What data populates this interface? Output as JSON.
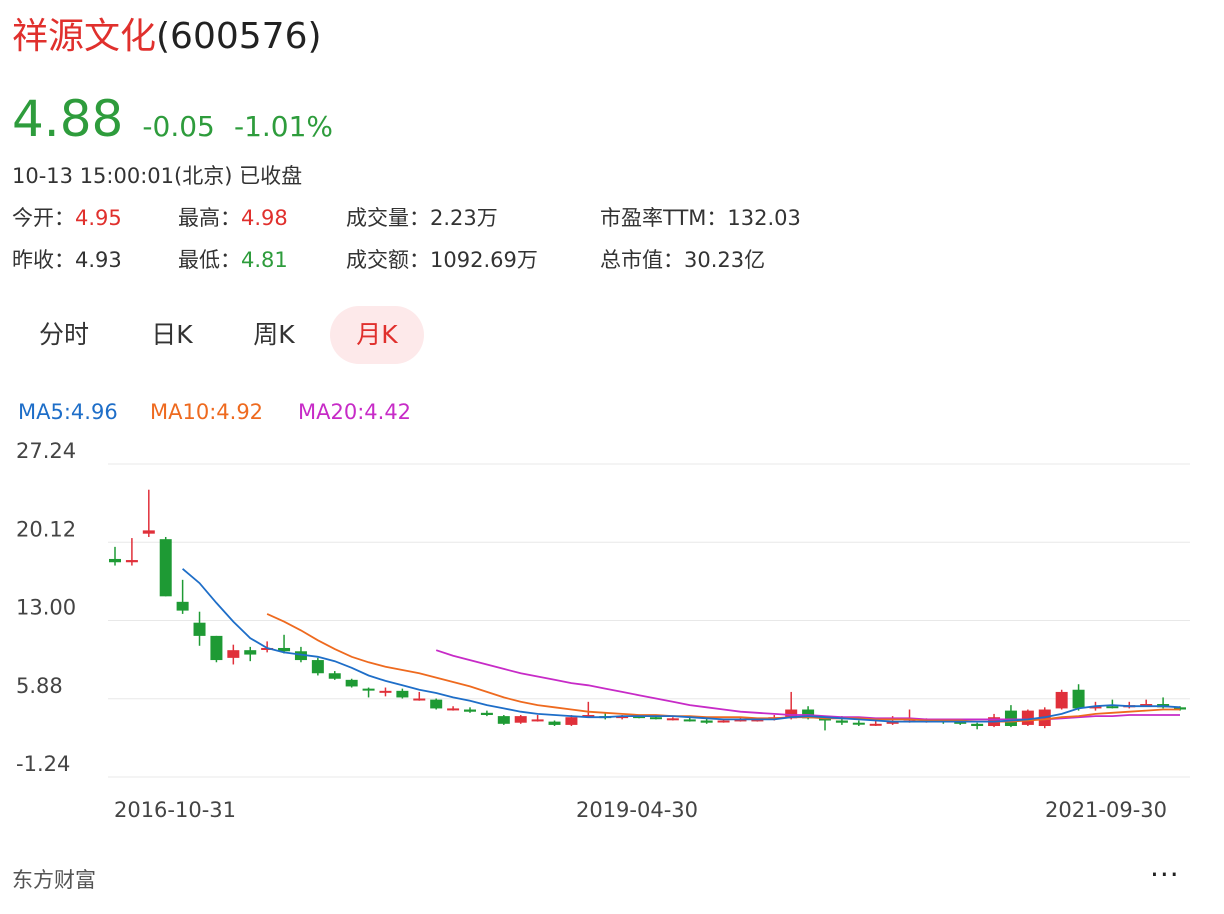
{
  "header": {
    "stock_name": "祥源文化",
    "stock_code": "(600576)"
  },
  "quote": {
    "price": "4.88",
    "change": "-0.05",
    "change_pct": "-1.01%"
  },
  "status_time": "10-13 15:00:01(北京) 已收盘",
  "stats": {
    "open_label": "今开：",
    "open": "4.95",
    "high_label": "最高：",
    "high": "4.98",
    "volume_label": "成交量：",
    "volume": "2.23万",
    "pe_label": "市盈率TTM：",
    "pe": "132.03",
    "prev_close_label": "昨收：",
    "prev_close": "4.93",
    "low_label": "最低：",
    "low": "4.81",
    "amount_label": "成交额：",
    "amount": "1092.69万",
    "mktcap_label": "总市值：",
    "mktcap": "30.23亿"
  },
  "tabs": [
    {
      "label": "分时"
    },
    {
      "label": "日K"
    },
    {
      "label": "周K"
    },
    {
      "label": "月K",
      "active": true
    }
  ],
  "ma_legend": [
    {
      "label": "MA5:4.96",
      "color": "#1e6ec8"
    },
    {
      "label": "MA10:4.92",
      "color": "#ee6a1f"
    },
    {
      "label": "MA20:4.42",
      "color": "#c72bc7"
    }
  ],
  "chart_data": {
    "type": "candlestick",
    "y_ticks": [
      "27.24",
      "20.12",
      "13.00",
      "5.88",
      "-1.24"
    ],
    "ylim": [
      -1.24,
      27.24
    ],
    "x_labels": [
      "2016-10-31",
      "2019-04-30",
      "2021-09-30"
    ],
    "colors": {
      "up": "#e0303a",
      "down": "#1e9a34",
      "ma5": "#1e6ec8",
      "ma10": "#ee6a1f",
      "ma20": "#c72bc7"
    },
    "candles": [
      [
        18.6,
        18.3,
        19.7,
        18.0
      ],
      [
        18.3,
        18.5,
        20.5,
        18.0
      ],
      [
        20.9,
        21.2,
        24.9,
        20.6
      ],
      [
        20.4,
        15.2,
        20.6,
        15.2
      ],
      [
        14.7,
        13.9,
        16.7,
        13.6
      ],
      [
        12.8,
        11.6,
        13.8,
        10.7
      ],
      [
        11.6,
        9.4,
        11.6,
        9.2
      ],
      [
        9.6,
        10.3,
        10.8,
        9.0
      ],
      [
        10.3,
        9.9,
        10.6,
        9.3
      ],
      [
        10.4,
        10.5,
        11.1,
        10.1
      ],
      [
        10.5,
        10.2,
        11.7,
        10.0
      ],
      [
        10.2,
        9.4,
        10.6,
        9.2
      ],
      [
        9.4,
        8.2,
        9.6,
        8.0
      ],
      [
        8.2,
        7.7,
        8.4,
        7.6
      ],
      [
        7.6,
        7.0,
        7.7,
        6.9
      ],
      [
        6.8,
        6.7,
        6.9,
        6.0
      ],
      [
        6.6,
        6.6,
        6.9,
        6.1
      ],
      [
        6.6,
        6.0,
        6.8,
        5.9
      ],
      [
        5.9,
        5.9,
        6.5,
        5.7
      ],
      [
        5.8,
        5.0,
        5.9,
        4.9
      ],
      [
        4.9,
        5.0,
        5.2,
        4.8
      ],
      [
        4.9,
        4.7,
        5.1,
        4.6
      ],
      [
        4.6,
        4.4,
        4.8,
        4.3
      ],
      [
        4.3,
        3.6,
        4.4,
        3.5
      ],
      [
        3.7,
        4.3,
        4.4,
        3.6
      ],
      [
        4.0,
        4.0,
        4.4,
        3.8
      ],
      [
        3.8,
        3.5,
        3.9,
        3.4
      ],
      [
        3.5,
        4.2,
        4.4,
        3.4
      ],
      [
        4.4,
        4.4,
        5.6,
        4.2
      ],
      [
        4.3,
        4.2,
        4.6,
        4.0
      ],
      [
        4.2,
        4.3,
        4.4,
        4.0
      ],
      [
        4.3,
        4.2,
        4.4,
        4.1
      ],
      [
        4.2,
        4.1,
        4.4,
        4.0
      ],
      [
        4.1,
        4.1,
        4.2,
        3.9
      ],
      [
        4.0,
        3.9,
        4.2,
        3.8
      ],
      [
        3.9,
        3.7,
        4.1,
        3.6
      ],
      [
        3.8,
        3.9,
        4.0,
        3.7
      ],
      [
        3.9,
        4.0,
        4.2,
        3.8
      ],
      [
        4.0,
        4.0,
        4.1,
        3.8
      ],
      [
        4.0,
        4.2,
        4.4,
        3.9
      ],
      [
        4.1,
        4.9,
        6.5,
        4.0
      ],
      [
        4.9,
        4.1,
        5.2,
        4.0
      ],
      [
        4.1,
        3.9,
        4.2,
        3.0
      ],
      [
        3.9,
        3.7,
        4.3,
        3.5
      ],
      [
        3.7,
        3.6,
        3.9,
        3.4
      ],
      [
        3.6,
        3.6,
        4.1,
        3.4
      ],
      [
        3.6,
        3.8,
        4.3,
        3.5
      ],
      [
        3.8,
        3.9,
        4.9,
        3.7
      ],
      [
        3.9,
        3.9,
        4.1,
        3.7
      ],
      [
        3.9,
        3.8,
        4.0,
        3.6
      ],
      [
        3.8,
        3.6,
        3.9,
        3.5
      ],
      [
        3.6,
        3.4,
        3.7,
        3.1
      ],
      [
        3.4,
        4.2,
        4.5,
        3.3
      ],
      [
        4.8,
        3.4,
        5.3,
        3.3
      ],
      [
        3.5,
        4.8,
        4.9,
        3.4
      ],
      [
        3.4,
        4.9,
        5.1,
        3.2
      ],
      [
        5.0,
        6.5,
        6.7,
        4.9
      ],
      [
        6.7,
        5.0,
        7.2,
        4.8
      ],
      [
        5.0,
        5.2,
        5.6,
        4.8
      ],
      [
        5.2,
        5.1,
        5.8,
        5.0
      ],
      [
        5.1,
        5.3,
        5.6,
        5.0
      ],
      [
        5.3,
        5.4,
        5.8,
        5.2
      ],
      [
        5.4,
        5.1,
        6.0,
        5.0
      ],
      [
        5.1,
        4.9,
        5.2,
        4.8
      ]
    ],
    "ma5": [
      [
        4,
        17.7
      ],
      [
        5,
        16.4
      ],
      [
        6,
        14.6
      ],
      [
        7,
        12.9
      ],
      [
        8,
        11.4
      ],
      [
        9,
        10.5
      ],
      [
        10,
        10.1
      ],
      [
        11,
        9.9
      ],
      [
        12,
        9.7
      ],
      [
        13,
        9.3
      ],
      [
        14,
        8.7
      ],
      [
        15,
        8.0
      ],
      [
        16,
        7.5
      ],
      [
        17,
        7.1
      ],
      [
        18,
        6.7
      ],
      [
        19,
        6.4
      ],
      [
        20,
        6.0
      ],
      [
        21,
        5.7
      ],
      [
        22,
        5.3
      ],
      [
        23,
        5.0
      ],
      [
        24,
        4.7
      ],
      [
        25,
        4.5
      ],
      [
        26,
        4.4
      ],
      [
        27,
        4.3
      ],
      [
        28,
        4.2
      ],
      [
        29,
        4.2
      ],
      [
        30,
        4.3
      ],
      [
        31,
        4.3
      ],
      [
        32,
        4.3
      ],
      [
        33,
        4.3
      ],
      [
        34,
        4.2
      ],
      [
        35,
        4.1
      ],
      [
        36,
        4.0
      ],
      [
        37,
        4.0
      ],
      [
        38,
        4.0
      ],
      [
        39,
        4.0
      ],
      [
        40,
        4.2
      ],
      [
        41,
        4.3
      ],
      [
        42,
        4.2
      ],
      [
        43,
        4.1
      ],
      [
        44,
        4.0
      ],
      [
        45,
        3.9
      ],
      [
        46,
        3.8
      ],
      [
        47,
        3.8
      ],
      [
        48,
        3.8
      ],
      [
        49,
        3.8
      ],
      [
        50,
        3.8
      ],
      [
        51,
        3.8
      ],
      [
        52,
        3.8
      ],
      [
        53,
        3.9
      ],
      [
        54,
        4.0
      ],
      [
        55,
        4.2
      ],
      [
        56,
        4.5
      ],
      [
        57,
        5.0
      ],
      [
        58,
        5.2
      ],
      [
        59,
        5.3
      ],
      [
        60,
        5.2
      ],
      [
        61,
        5.2
      ],
      [
        62,
        5.2
      ],
      [
        63,
        5.1
      ]
    ],
    "ma10": [
      [
        9,
        13.6
      ],
      [
        10,
        12.9
      ],
      [
        11,
        12.1
      ],
      [
        12,
        11.2
      ],
      [
        13,
        10.4
      ],
      [
        14,
        9.7
      ],
      [
        15,
        9.2
      ],
      [
        16,
        8.8
      ],
      [
        17,
        8.5
      ],
      [
        18,
        8.2
      ],
      [
        19,
        7.8
      ],
      [
        20,
        7.4
      ],
      [
        21,
        7.0
      ],
      [
        22,
        6.5
      ],
      [
        23,
        6.0
      ],
      [
        24,
        5.6
      ],
      [
        25,
        5.3
      ],
      [
        26,
        5.1
      ],
      [
        27,
        4.9
      ],
      [
        28,
        4.7
      ],
      [
        29,
        4.6
      ],
      [
        30,
        4.5
      ],
      [
        31,
        4.4
      ],
      [
        32,
        4.4
      ],
      [
        33,
        4.3
      ],
      [
        34,
        4.3
      ],
      [
        35,
        4.2
      ],
      [
        36,
        4.2
      ],
      [
        37,
        4.2
      ],
      [
        38,
        4.1
      ],
      [
        39,
        4.1
      ],
      [
        40,
        4.2
      ],
      [
        41,
        4.2
      ],
      [
        42,
        4.1
      ],
      [
        43,
        4.1
      ],
      [
        44,
        4.1
      ],
      [
        45,
        4.0
      ],
      [
        46,
        4.0
      ],
      [
        47,
        4.0
      ],
      [
        48,
        3.9
      ],
      [
        49,
        3.9
      ],
      [
        50,
        3.9
      ],
      [
        51,
        3.8
      ],
      [
        52,
        3.8
      ],
      [
        53,
        3.8
      ],
      [
        54,
        3.9
      ],
      [
        55,
        4.0
      ],
      [
        56,
        4.2
      ],
      [
        57,
        4.3
      ],
      [
        58,
        4.5
      ],
      [
        59,
        4.6
      ],
      [
        60,
        4.7
      ],
      [
        61,
        4.8
      ],
      [
        62,
        4.9
      ],
      [
        63,
        4.9
      ]
    ],
    "ma20": [
      [
        19,
        10.3
      ],
      [
        20,
        9.8
      ],
      [
        21,
        9.4
      ],
      [
        22,
        9.0
      ],
      [
        23,
        8.6
      ],
      [
        24,
        8.2
      ],
      [
        25,
        7.9
      ],
      [
        26,
        7.6
      ],
      [
        27,
        7.3
      ],
      [
        28,
        7.1
      ],
      [
        29,
        6.8
      ],
      [
        30,
        6.5
      ],
      [
        31,
        6.2
      ],
      [
        32,
        5.9
      ],
      [
        33,
        5.6
      ],
      [
        34,
        5.3
      ],
      [
        35,
        5.1
      ],
      [
        36,
        4.9
      ],
      [
        37,
        4.7
      ],
      [
        38,
        4.6
      ],
      [
        39,
        4.5
      ],
      [
        40,
        4.4
      ],
      [
        41,
        4.4
      ],
      [
        42,
        4.3
      ],
      [
        43,
        4.2
      ],
      [
        44,
        4.2
      ],
      [
        45,
        4.1
      ],
      [
        46,
        4.1
      ],
      [
        47,
        4.1
      ],
      [
        48,
        4.0
      ],
      [
        49,
        4.0
      ],
      [
        50,
        4.0
      ],
      [
        51,
        4.0
      ],
      [
        52,
        4.0
      ],
      [
        53,
        4.0
      ],
      [
        54,
        4.0
      ],
      [
        55,
        4.0
      ],
      [
        56,
        4.1
      ],
      [
        57,
        4.2
      ],
      [
        58,
        4.3
      ],
      [
        59,
        4.3
      ],
      [
        60,
        4.4
      ],
      [
        61,
        4.4
      ],
      [
        62,
        4.4
      ],
      [
        63,
        4.4
      ]
    ]
  },
  "footer": {
    "source": "东方财富",
    "more": "···"
  }
}
